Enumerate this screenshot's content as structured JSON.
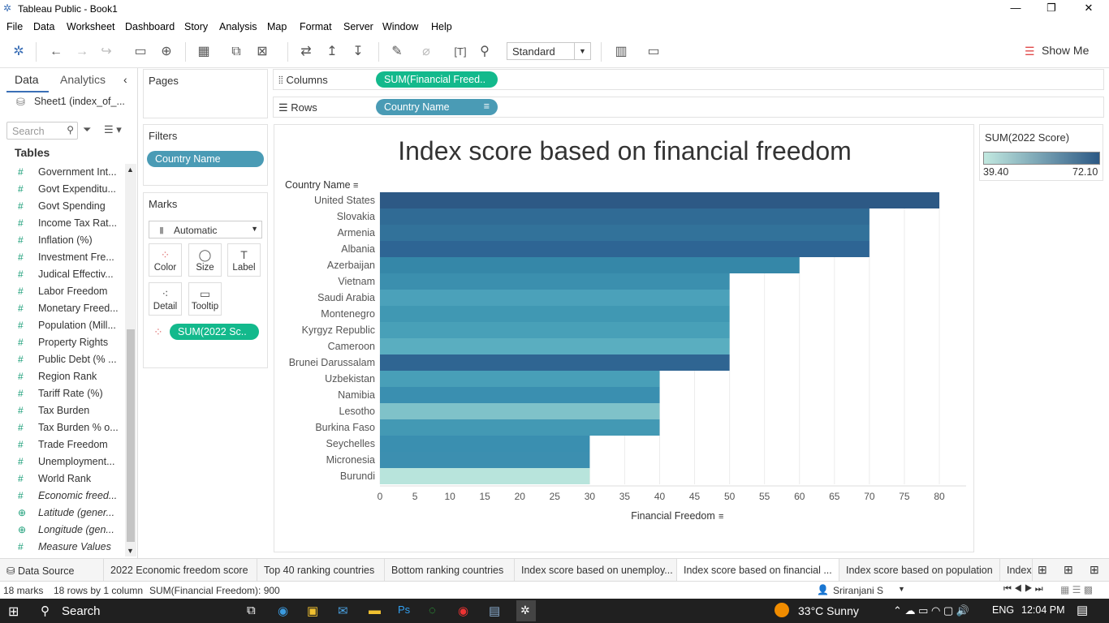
{
  "window": {
    "title": "Tableau Public - Book1"
  },
  "menu": [
    "File",
    "Data",
    "Worksheet",
    "Dashboard",
    "Story",
    "Analysis",
    "Map",
    "Format",
    "Server",
    "Window",
    "Help"
  ],
  "toolbar": {
    "fit": "Standard",
    "show_me": "Show Me"
  },
  "data_pane": {
    "tab_data": "Data",
    "tab_analytics": "Analytics",
    "source": "Sheet1 (index_of_...",
    "search_placeholder": "Search",
    "tables_header": "Tables",
    "fields": [
      "Government Int...",
      "Govt Expenditu...",
      "Govt Spending",
      "Income Tax Rat...",
      "Inflation (%)",
      "Investment Fre...",
      "Judical Effectiv...",
      "Labor Freedom",
      "Monetary Freed...",
      "Population (Mill...",
      "Property Rights",
      "Public Debt (% ...",
      "Region Rank",
      "Tariff Rate (%)",
      "Tax Burden",
      "Tax Burden % o...",
      "Trade Freedom",
      "Unemployment...",
      "World Rank",
      "Economic freed...",
      "Latitude (gener...",
      "Longitude (gen...",
      "Measure Values"
    ]
  },
  "pages": {
    "title": "Pages"
  },
  "filters": {
    "title": "Filters",
    "pill": "Country Name"
  },
  "marks": {
    "title": "Marks",
    "type": "Automatic",
    "color": "Color",
    "size": "Size",
    "label": "Label",
    "detail": "Detail",
    "tooltip": "Tooltip",
    "pill": "SUM(2022 Sc.."
  },
  "shelves": {
    "columns_label": "Columns",
    "columns_pill": "SUM(Financial Freed..",
    "rows_label": "Rows",
    "rows_pill": "Country Name"
  },
  "legend": {
    "title": "SUM(2022 Score)",
    "min": "39.40",
    "max": "72.10",
    "color_low": "#c2e9e0",
    "color_high": "#2c5985"
  },
  "chart_data": {
    "type": "bar",
    "title": "Index score based on financial freedom",
    "ylabel": "Country Name",
    "xlabel": "Financial Freedom",
    "xlim": [
      0,
      80
    ],
    "ticks": [
      "0",
      "5",
      "10",
      "15",
      "20",
      "25",
      "30",
      "35",
      "40",
      "45",
      "50",
      "55",
      "60",
      "65",
      "70",
      "75",
      "80"
    ],
    "categories": [
      "United States",
      "Slovakia",
      "Armenia",
      "Albania",
      "Azerbaijan",
      "Vietnam",
      "Saudi Arabia",
      "Montenegro",
      "Kyrgyz Republic",
      "Cameroon",
      "Brunei Darussalam",
      "Uzbekistan",
      "Namibia",
      "Lesotho",
      "Burkina Faso",
      "Seychelles",
      "Micronesia",
      "Burundi"
    ],
    "values": [
      80,
      70,
      70,
      70,
      60,
      50,
      50,
      50,
      50,
      50,
      50,
      40,
      40,
      40,
      40,
      30,
      30,
      30
    ],
    "colors": [
      "#2d5985",
      "#306b95",
      "#32729a",
      "#2e6594",
      "#3587a8",
      "#3b8fae",
      "#4ba1ba",
      "#4098b3",
      "#48a0b8",
      "#5aaec0",
      "#2f6592",
      "#489fb8",
      "#3a8fb0",
      "#7fc2c9",
      "#4399b4",
      "#3a8fb0",
      "#3c8fb0",
      "#b8e4dc"
    ]
  },
  "sheet_tabs": [
    "Data Source",
    "2022 Economic freedom score",
    "Top 40 ranking countries",
    "Bottom ranking countries",
    "Index score based on unemploy...",
    "Index score based on financial ...",
    "Index score based on population",
    "Index"
  ],
  "status": {
    "marks": "18 marks",
    "rows": "18 rows by 1 column",
    "sum": "SUM(Financial Freedom): 900",
    "user": "Sriranjani S"
  },
  "taskbar": {
    "search": "Search",
    "weather": "33°C  Sunny",
    "lang": "ENG",
    "time": "12:04 PM"
  }
}
